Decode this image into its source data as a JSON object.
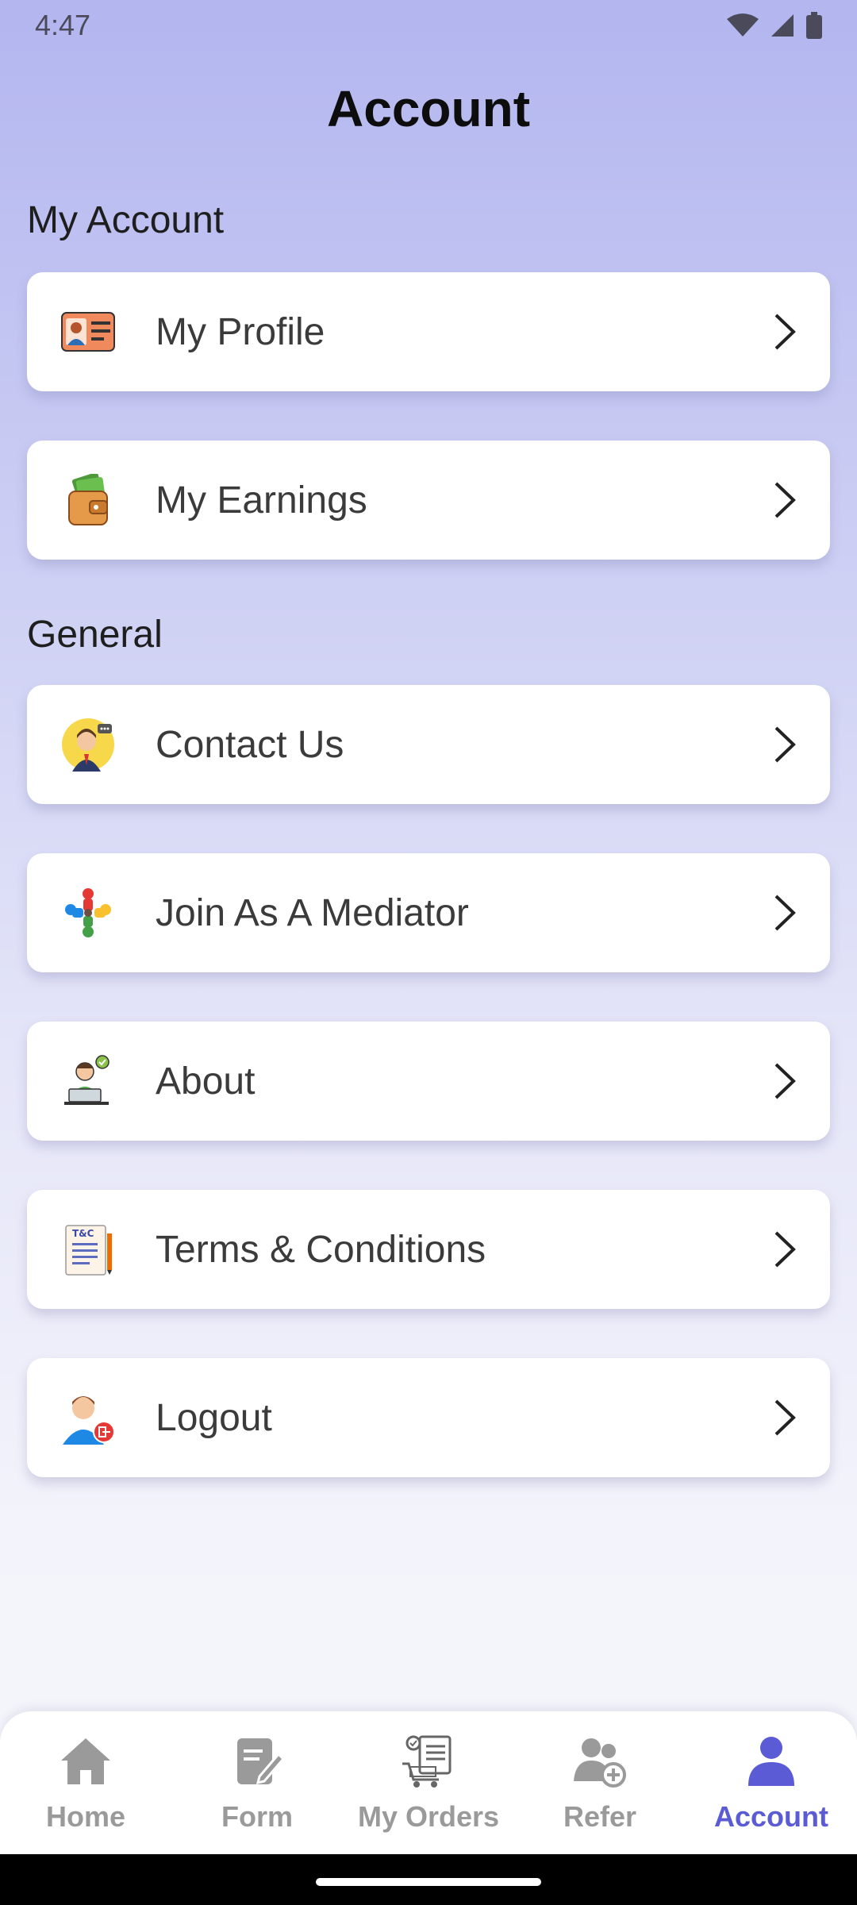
{
  "status_bar": {
    "time": "4:47",
    "icons": [
      "wifi-icon",
      "cell-signal-icon",
      "battery-icon"
    ]
  },
  "header": {
    "title": "Account"
  },
  "sections": [
    {
      "label": "My Account",
      "items": [
        {
          "label": "My Profile",
          "icon": "id-card-icon"
        },
        {
          "label": "My Earnings",
          "icon": "wallet-icon"
        }
      ]
    },
    {
      "label": "General",
      "items": [
        {
          "label": "Contact Us",
          "icon": "support-agent-icon"
        },
        {
          "label": "Join As A Mediator",
          "icon": "team-icon"
        },
        {
          "label": "About",
          "icon": "developer-icon"
        },
        {
          "label": "Terms & Conditions",
          "icon": "terms-document-icon"
        },
        {
          "label": "Logout",
          "icon": "logout-user-icon"
        }
      ]
    }
  ],
  "bottom_nav": {
    "items": [
      {
        "label": "Home",
        "icon": "home-icon",
        "active": false
      },
      {
        "label": "Form",
        "icon": "form-edit-icon",
        "active": false
      },
      {
        "label": "My Orders",
        "icon": "orders-cart-icon",
        "active": false
      },
      {
        "label": "Refer",
        "icon": "refer-user-icon",
        "active": false
      },
      {
        "label": "Account",
        "icon": "account-user-icon",
        "active": true
      }
    ]
  },
  "colors": {
    "accent": "#5b5bd6",
    "inactive_nav": "#9a9a9a",
    "background_top": "#b3b6ef",
    "background_bottom": "#f6f6fb"
  }
}
